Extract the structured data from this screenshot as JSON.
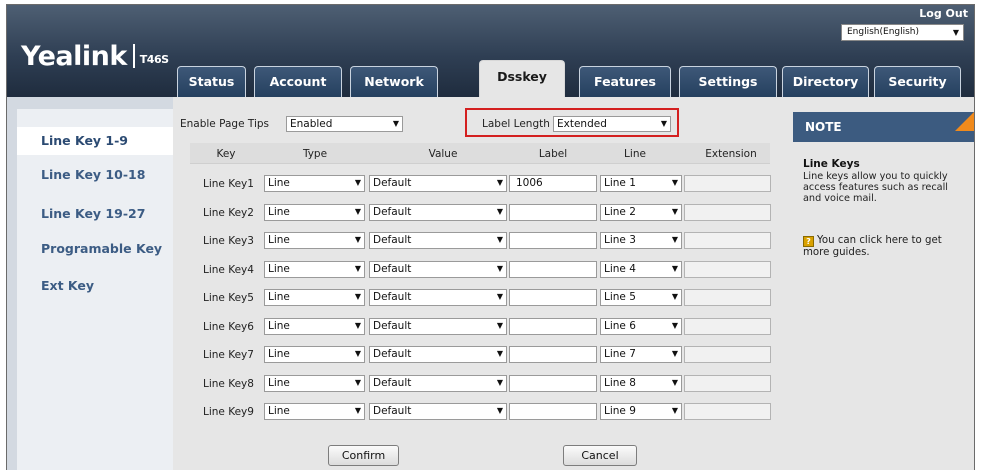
{
  "header": {
    "logo_text": "Yealink",
    "model": "T46S",
    "logout_label": "Log Out",
    "language_value": "English(English)"
  },
  "tabs": [
    {
      "label": "Status",
      "active": false
    },
    {
      "label": "Account",
      "active": false
    },
    {
      "label": "Network",
      "active": false
    },
    {
      "label": "Dsskey",
      "active": true
    },
    {
      "label": "Features",
      "active": false
    },
    {
      "label": "Settings",
      "active": false
    },
    {
      "label": "Directory",
      "active": false
    },
    {
      "label": "Security",
      "active": false
    }
  ],
  "sidebar": {
    "items": [
      {
        "label": "Line Key 1-9",
        "active": true
      },
      {
        "label": "Line Key 10-18",
        "active": false
      },
      {
        "label": "Line Key 19-27",
        "active": false
      },
      {
        "label": "Programable Key",
        "active": false
      },
      {
        "label": "Ext Key",
        "active": false
      }
    ]
  },
  "settings": {
    "page_tips_label": "Enable Page Tips",
    "page_tips_value": "Enabled",
    "label_length_label": "Label Length",
    "label_length_value": "Extended"
  },
  "table": {
    "headers": [
      "Key",
      "Type",
      "Value",
      "Label",
      "Line",
      "Extension"
    ],
    "rows": [
      {
        "key": "Line Key1",
        "type": "Line",
        "value": "Default",
        "label": "1006",
        "line": "Line 1",
        "extension": ""
      },
      {
        "key": "Line Key2",
        "type": "Line",
        "value": "Default",
        "label": "",
        "line": "Line 2",
        "extension": ""
      },
      {
        "key": "Line Key3",
        "type": "Line",
        "value": "Default",
        "label": "",
        "line": "Line 3",
        "extension": ""
      },
      {
        "key": "Line Key4",
        "type": "Line",
        "value": "Default",
        "label": "",
        "line": "Line 4",
        "extension": ""
      },
      {
        "key": "Line Key5",
        "type": "Line",
        "value": "Default",
        "label": "",
        "line": "Line 5",
        "extension": ""
      },
      {
        "key": "Line Key6",
        "type": "Line",
        "value": "Default",
        "label": "",
        "line": "Line 6",
        "extension": ""
      },
      {
        "key": "Line Key7",
        "type": "Line",
        "value": "Default",
        "label": "",
        "line": "Line 7",
        "extension": ""
      },
      {
        "key": "Line Key8",
        "type": "Line",
        "value": "Default",
        "label": "",
        "line": "Line 8",
        "extension": ""
      },
      {
        "key": "Line Key9",
        "type": "Line",
        "value": "Default",
        "label": "",
        "line": "Line 9",
        "extension": ""
      }
    ]
  },
  "buttons": {
    "confirm_label": "Confirm",
    "cancel_label": "Cancel"
  },
  "note": {
    "header": "NOTE",
    "title": "Line Keys",
    "text": "Line keys allow you to quickly access features such as recall and voice mail.",
    "guide_text": "You can click here to get more guides.",
    "guide_icon": "help-book-icon"
  },
  "colors": {
    "header_bg": "#2f3f54",
    "tab_bg": "#2c4767",
    "nav_text": "#3c5c84",
    "note_header": "#3c5b80",
    "note_corner": "#f08a1c",
    "highlight_border": "#d42020"
  }
}
